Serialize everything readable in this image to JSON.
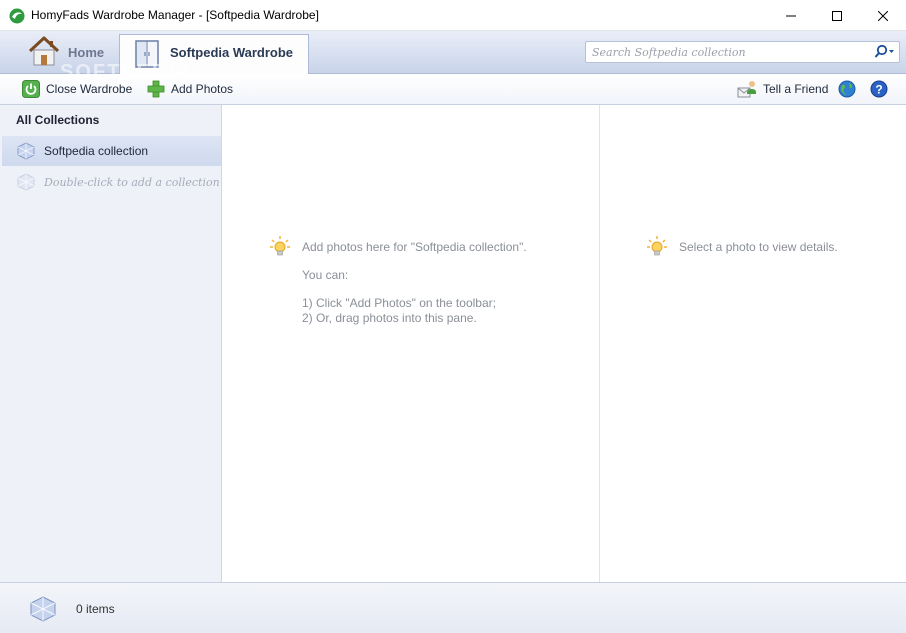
{
  "window": {
    "title": "HomyFads Wardrobe Manager - [Softpedia Wardrobe]"
  },
  "nav": {
    "home_label": "Home",
    "wardrobe_label": "Softpedia Wardrobe",
    "watermark": "SOFTPEDIA"
  },
  "search": {
    "placeholder": "Search Softpedia collection"
  },
  "toolbar": {
    "close_wardrobe": "Close Wardrobe",
    "add_photos": "Add Photos",
    "tell_friend": "Tell a Friend"
  },
  "sidebar": {
    "header": "All Collections",
    "items": [
      {
        "label": "Softpedia collection"
      },
      {
        "label": "Double-click to add a collection"
      }
    ]
  },
  "middle_pane": {
    "line1": "Add photos here for \"Softpedia collection\".",
    "line2": "You can:",
    "line3": "1) Click \"Add Photos\" on the toolbar;",
    "line4": "2) Or, drag photos into this pane."
  },
  "right_pane": {
    "hint": "Select a photo to view details."
  },
  "status": {
    "items_count": "0 items"
  },
  "colors": {
    "nav_gradient_top": "#e9eef8",
    "nav_gradient_bottom": "#c9d4ea",
    "sidebar_bg": "#eef1f8",
    "hint_text": "#8a8f98",
    "accent_green": "#4caf50"
  }
}
